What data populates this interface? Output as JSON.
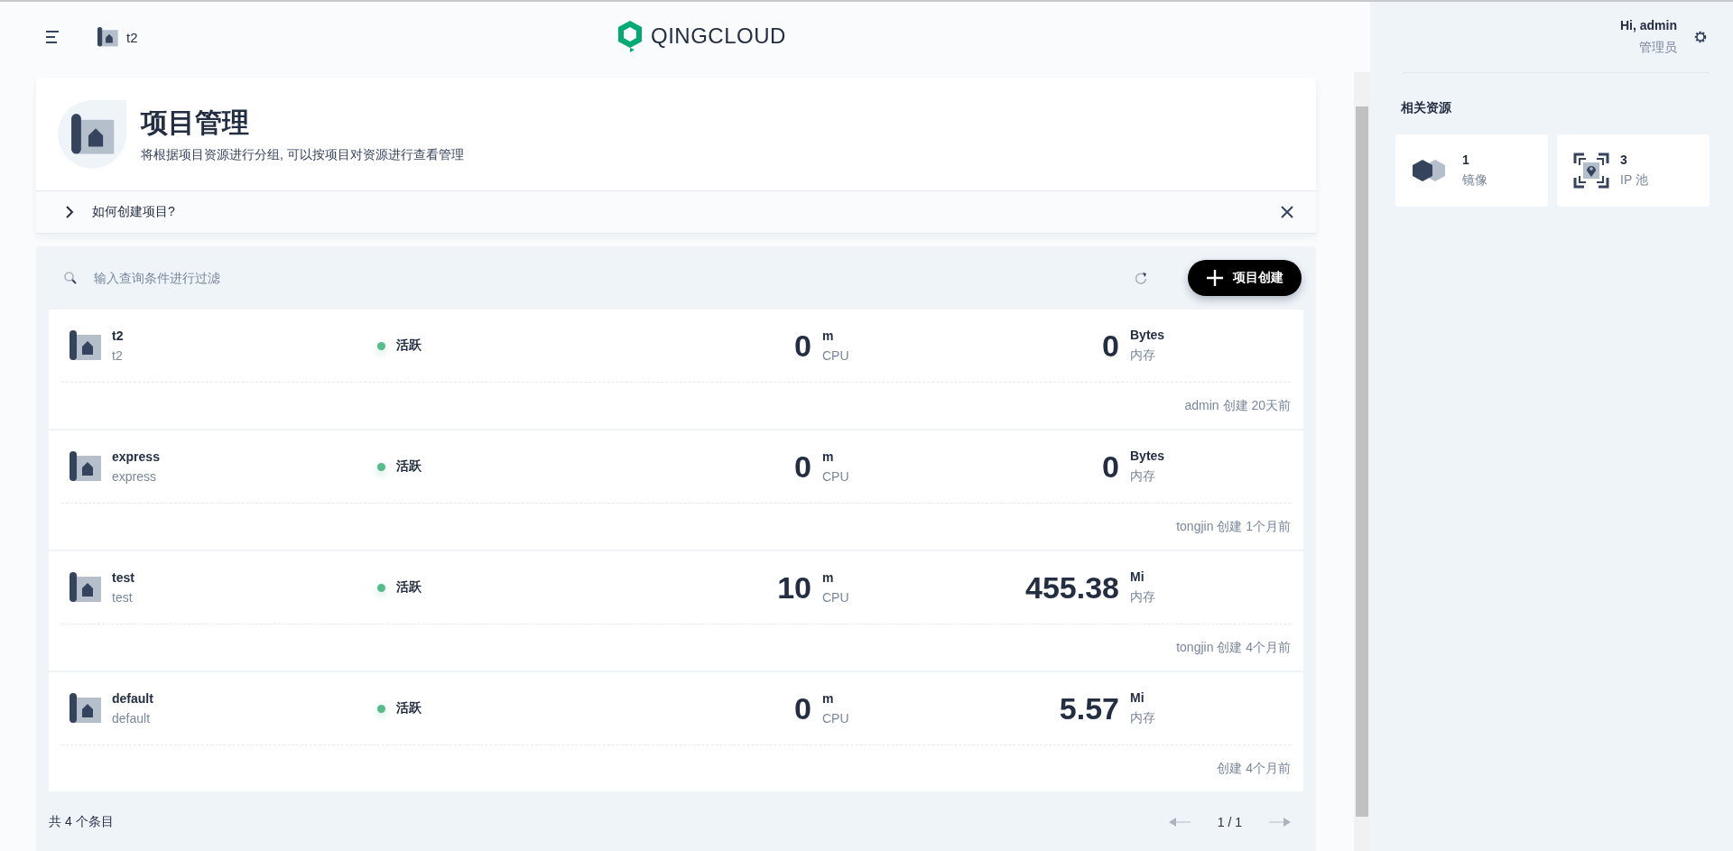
{
  "header": {
    "project": "t2",
    "logo": "QINGCLOUD"
  },
  "page": {
    "title": "项目管理",
    "description": "将根据项目资源进行分组, 可以按项目对资源进行查看管理",
    "tip": {
      "text": "如何创建项目?",
      "expanded": false
    }
  },
  "toolbar": {
    "search": {
      "placeholder": "输入查询条件进行过滤"
    },
    "create_button": "项目创建"
  },
  "projects": [
    {
      "name": "t2",
      "alias": "t2",
      "status": "活跃",
      "color": "#55bc8a",
      "cpu": "0",
      "cpu_unit": "m",
      "cpu_label": "CPU",
      "memory": "0",
      "memory_unit": "Bytes",
      "memory_label": "内存",
      "created": "admin 创建 20天前"
    },
    {
      "name": "express",
      "alias": "express",
      "status": "活跃",
      "color": "#55bc8a",
      "cpu": "0",
      "cpu_unit": "m",
      "cpu_label": "CPU",
      "memory": "0",
      "memory_unit": "Bytes",
      "memory_label": "内存",
      "created": "tongjin 创建 1个月前"
    },
    {
      "name": "test",
      "alias": "test",
      "status": "活跃",
      "color": "#55bc8a",
      "cpu": "10",
      "cpu_unit": "m",
      "cpu_label": "CPU",
      "memory": "455.38",
      "memory_unit": "Mi",
      "memory_label": "内存",
      "created": "tongjin 创建 4个月前"
    },
    {
      "name": "default",
      "alias": "default",
      "status": "活跃",
      "color": "#55bc8a",
      "cpu": "0",
      "cpu_unit": "m",
      "cpu_label": "CPU",
      "memory": "5.57",
      "memory_unit": "Mi",
      "memory_label": "内存",
      "created": "创建 4个月前"
    }
  ],
  "footer": {
    "total": "共 4 个条目",
    "page": "1 / 1"
  },
  "user": {
    "greeting": "Hi, admin",
    "role": "管理员"
  },
  "resources": {
    "title": "相关资源",
    "items": [
      {
        "kind": "image",
        "count": "1",
        "label": "镜像"
      },
      {
        "kind": "ippool",
        "count": "3",
        "label": "IP 池"
      }
    ]
  }
}
